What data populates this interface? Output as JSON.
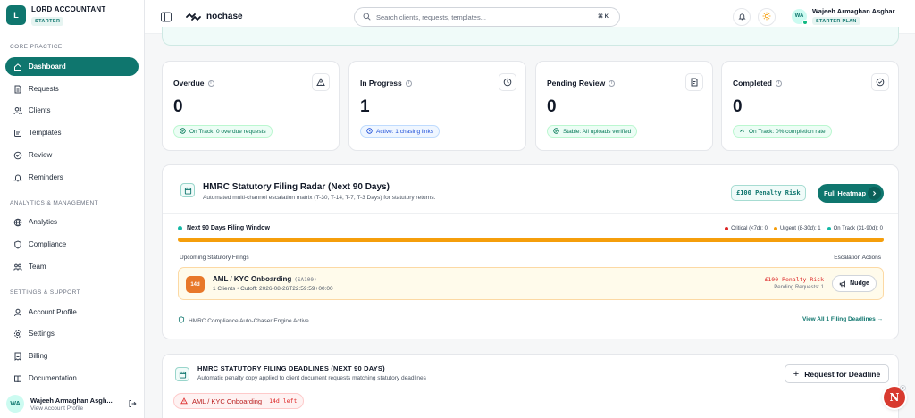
{
  "brand": {
    "initial": "L",
    "name": "LORD ACCOUNTANT",
    "badge": "STARTER"
  },
  "sidebar": {
    "sections": [
      "CORE PRACTICE",
      "ANALYTICS & MANAGEMENT",
      "SETTINGS & SUPPORT"
    ],
    "items": [
      {
        "label": "Dashboard",
        "icon": "home-icon",
        "active": true
      },
      {
        "label": "Requests",
        "icon": "document-icon"
      },
      {
        "label": "Clients",
        "icon": "users-icon"
      },
      {
        "label": "Templates",
        "icon": "template-icon"
      },
      {
        "label": "Review",
        "icon": "check-circle-icon"
      },
      {
        "label": "Reminders",
        "icon": "bell-icon"
      },
      {
        "label": "Analytics",
        "icon": "globe-icon"
      },
      {
        "label": "Compliance",
        "icon": "shield-icon"
      },
      {
        "label": "Team",
        "icon": "team-icon"
      },
      {
        "label": "Account Profile",
        "icon": "user-icon"
      },
      {
        "label": "Settings",
        "icon": "gear-icon"
      },
      {
        "label": "Billing",
        "icon": "billing-icon"
      },
      {
        "label": "Documentation",
        "icon": "book-icon"
      }
    ],
    "user": {
      "initials": "WA",
      "name": "Wajeeh Armaghan Asgh...",
      "sub": "View Account Profile"
    }
  },
  "header": {
    "logo": "nochase",
    "search_placeholder": "Search clients, requests, templates...",
    "shortcut": "⌘ K",
    "user": {
      "initials": "WA",
      "name": "Wajeeh Armaghan Asghar",
      "plan": "STARTER PLAN"
    }
  },
  "stats": [
    {
      "title": "Overdue",
      "value": "0",
      "pill": "On Track: 0 overdue requests",
      "pill_color": "green",
      "icon": "warning-icon"
    },
    {
      "title": "In Progress",
      "value": "1",
      "pill": "Active: 1 chasing links",
      "pill_color": "blue",
      "icon": "clock-icon"
    },
    {
      "title": "Pending Review",
      "value": "0",
      "pill": "Stable: All uploads verified",
      "pill_color": "green",
      "icon": "review-doc-icon"
    },
    {
      "title": "Completed",
      "value": "0",
      "pill": "On Track: 0% completion rate",
      "pill_color": "green",
      "icon": "check-circle-icon"
    }
  ],
  "radar": {
    "title": "HMRC Statutory Filing Radar (Next 90 Days)",
    "subtitle": "Automated multi-channel escalation matrix (T-30, T-14, T-7, T-3 Days) for statutory returns.",
    "penalty_badge": "£100 Penalty Risk",
    "heatmap_button": "Full Heatmap",
    "window_label": "Next 90 Days Filing Window",
    "legend": [
      {
        "label": "Critical (<7d): 0",
        "color": "#dc2626"
      },
      {
        "label": "Urgent (8-30d): 1",
        "color": "#f59e0b"
      },
      {
        "label": "On Track (31-90d): 0",
        "color": "#14b8a6"
      }
    ],
    "progress_fraction": 1.0,
    "upcoming_label": "Upcoming Statutory Filings",
    "escalation_label": "Escalation Actions",
    "filing": {
      "days": "14d",
      "name": "AML / KYC Onboarding",
      "code": "(SA100)",
      "meta": "1 Clients • Cutoff: 2026-08-26T22:59:59+00:00",
      "penalty": "£100 Penalty Risk",
      "pending": "Pending Requests: 1",
      "nudge": "Nudge"
    },
    "engine_label": "HMRC Compliance Auto-Chaser Engine Active",
    "view_all": "View All 1 Filing Deadlines →"
  },
  "deadlines": {
    "title": "HMRC STATUTORY FILING DEADLINES (NEXT 90 DAYS)",
    "subtitle": "Automatic penalty copy applied to client document requests matching statutory deadlines",
    "request_button": "Request for Deadline",
    "chip": {
      "label": "AML / KYC Onboarding",
      "days": "14d left"
    }
  },
  "float_button": "N",
  "colors": {
    "accent": "#0f766e",
    "warning": "#f59e0b",
    "danger": "#dc2626"
  }
}
